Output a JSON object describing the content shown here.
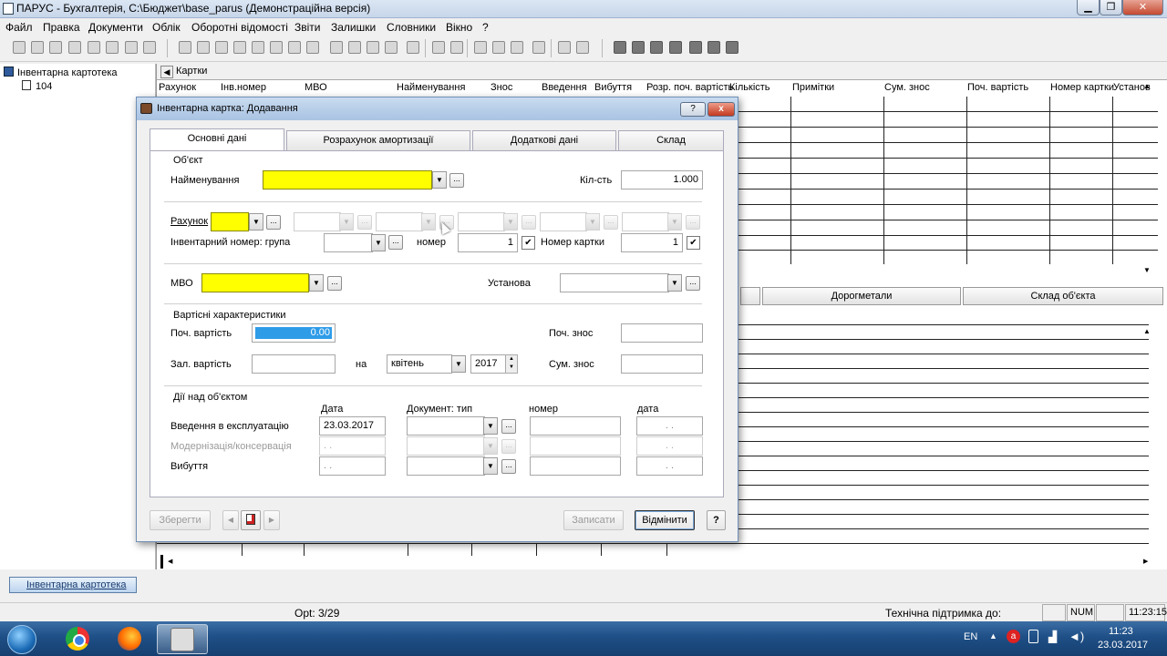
{
  "app": {
    "title": "ПАРУС - Бухгалтерія, C:\\Бюджет\\base_parus (Демонстраційна версія)"
  },
  "menu": [
    "Файл",
    "Правка",
    "Документи",
    "Облік",
    "Оборотні відомості",
    "Звіти",
    "Залишки",
    "Словники",
    "Вікно",
    "?"
  ],
  "tree": {
    "root": "Інвентарна картотека",
    "child": "104"
  },
  "grid": {
    "title": "Картки",
    "columns": [
      "Рахунок",
      "Інв.номер",
      "МВО",
      "Найменування",
      "Знос",
      "Введення",
      "Вибуття",
      "Розр. поч. вартість",
      "Кількість",
      "Примітки",
      "Сум. знос",
      "Поч. вартість",
      "Номер картки",
      "Установ"
    ],
    "subtabs": [
      "Дорогметали",
      "Склад об'єкта"
    ]
  },
  "dialog": {
    "title": "Інвентарна картка: Додавання",
    "help_label": "?",
    "close_label": "x",
    "tabs": [
      "Основні дані",
      "Розрахунок амортизації",
      "Додаткові дані",
      "Склад"
    ],
    "object_section": "Об'єкт",
    "name_label": "Найменування",
    "name_value": "",
    "qty_label": "Кіл-сть",
    "qty_value": "1.000",
    "account_label": "Рахунок",
    "inv_group_label": "Інвентарний номер: група",
    "number_label": "номер",
    "number_value": "1",
    "card_number_label": "Номер картки",
    "card_number_value": "1",
    "mvo_label": "МВО",
    "institution_label": "Установа",
    "cost_section": "Вартісні характеристики",
    "initial_cost_label": "Поч. вартість",
    "initial_cost_value": "0.00",
    "initial_wear_label": "Поч. знос",
    "residual_cost_label": "Зал. вартість",
    "on_label": "на",
    "month_value": "квітень",
    "year_value": "2017",
    "total_wear_label": "Сум. знос",
    "actions_section": "Дії над об'єктом",
    "col_date": "Дата",
    "col_doc_type": "Документ: тип",
    "col_doc_number": "номер",
    "col_doc_date": "дата",
    "action_rows": [
      {
        "label": "Введення в експлуатацію",
        "date": "23.03.2017",
        "doc_date": ". .",
        "disabled": false
      },
      {
        "label": "Модернізація/консервація",
        "date": ". .",
        "doc_date": ". .",
        "disabled": true
      },
      {
        "label": "Вибуття",
        "date": ". .",
        "doc_date": ". .",
        "disabled": false
      }
    ],
    "ellipsis": "...",
    "check_mark": "✔",
    "buttons": {
      "save": "Зберегти",
      "write": "Записати",
      "cancel": "Відмінити",
      "help": "?"
    }
  },
  "window_tab": "Інвентарна картотека",
  "status": {
    "record": "Орt: 3/29",
    "support": "Технічна підтримка до:",
    "num": "NUM",
    "time": "11:23:15"
  },
  "taskbar": {
    "lang": "EN",
    "clock_time": "11:23",
    "clock_date": "23.03.2017"
  },
  "colors": {
    "required_field": "#ffff00",
    "highlight": "#2f9ce8",
    "taskbar": "#1e4f86"
  }
}
